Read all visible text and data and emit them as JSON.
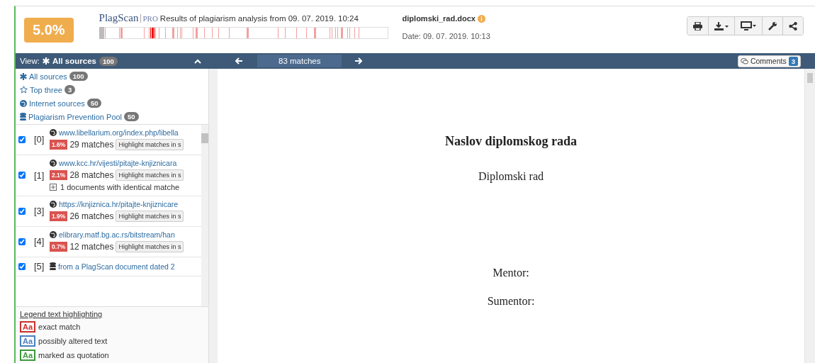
{
  "header": {
    "score": "5.0%",
    "brand": "PlagScan",
    "edition": "PRO",
    "analysis_title": "Results of plagiarism analysis from 09. 07. 2019. 10:24",
    "filename": "diplomski_rad.docx",
    "date": "Date: 09. 07. 2019. 10:13"
  },
  "view": {
    "label": "View:",
    "current": "All sources",
    "count": "100"
  },
  "navigation": {
    "matches": "83 matches"
  },
  "comments": {
    "label": "Comments",
    "count": "3"
  },
  "filters": [
    {
      "kind": "all",
      "label": "All sources",
      "count": "100"
    },
    {
      "kind": "top",
      "label": "Top three",
      "count": "3"
    },
    {
      "kind": "internet",
      "label": "Internet sources",
      "count": "50"
    },
    {
      "kind": "pool",
      "label": "Plagiarism Prevention Pool",
      "count": "50"
    }
  ],
  "sources": [
    {
      "kind": "internet",
      "checked": true,
      "index": "[0]",
      "link": "www.libellarium.org/index.php/libella",
      "percent": "1.6%",
      "matches": "29 matches",
      "action": "Highlight matches in s"
    },
    {
      "kind": "internet",
      "checked": true,
      "index": "[1]",
      "link": "www.kcc.hr/vijesti/pitajte-knjiznicara",
      "percent": "2.1%",
      "matches": "28 matches",
      "action": "Highlight matches in s",
      "identical": "1 documents with identical matche"
    },
    {
      "kind": "internet",
      "checked": true,
      "index": "[3]",
      "link": "https://knjiznica.hr/pitajte-knjiznicare",
      "percent": "1.9%",
      "matches": "26 matches",
      "action": "Highlight matches in s"
    },
    {
      "kind": "internet",
      "checked": true,
      "index": "[4]",
      "link": "elibrary.matf.bg.ac.rs/bitstream/han",
      "percent": "0.7%",
      "matches": "12 matches",
      "action": "Highlight matches in s"
    },
    {
      "kind": "pool",
      "checked": true,
      "index": "[5]",
      "link": "from a PlagScan document dated 2"
    }
  ],
  "legend": {
    "title": "Legend text highlighting",
    "items": [
      {
        "sample": "Aa",
        "label": "exact match",
        "color": "#c9302c"
      },
      {
        "sample": "Aa",
        "label": "possibly altered text",
        "color": "#4a7fc1"
      },
      {
        "sample": "Aa",
        "label": "marked as quotation",
        "color": "#3c9a3c"
      }
    ]
  },
  "document": {
    "title": "Naslov diplomskog rada",
    "subtitle": "Diplomski rad",
    "lines": [
      "Mentor:",
      "Sumentor:"
    ]
  }
}
